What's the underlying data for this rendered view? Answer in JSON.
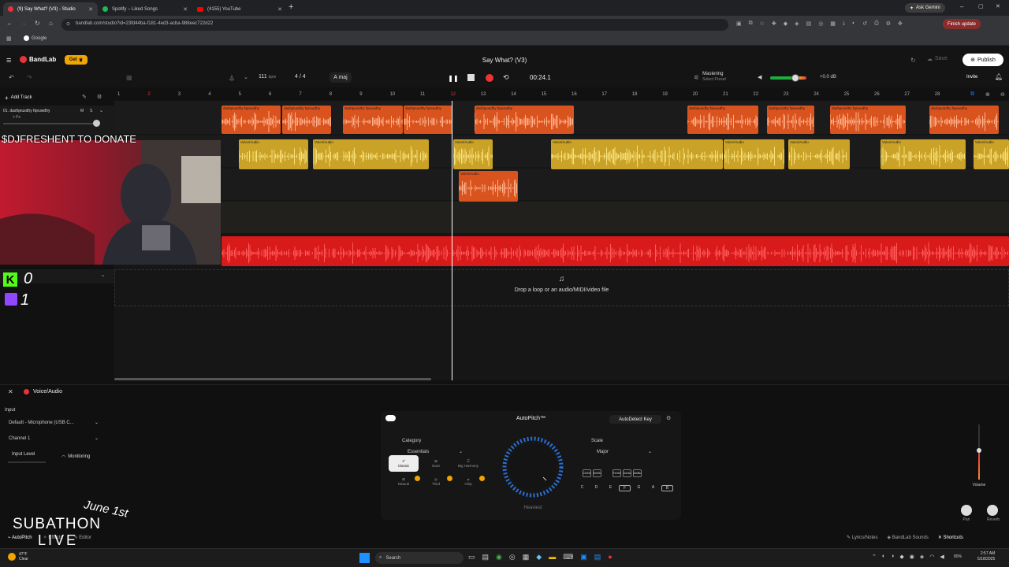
{
  "browser": {
    "tabs": [
      {
        "label": "(9) Say What? (V3) - Studio",
        "active": true
      },
      {
        "label": "Spotify – Liked Songs",
        "active": false
      },
      {
        "label": "(4155) YouTube",
        "active": false
      }
    ],
    "url": "bandlab.com/studio?id=23fd44ba-f181-4ed3-acba-988eec722d22",
    "bookmark": "Google",
    "ask_gemini": "Ask Gemini",
    "finish_update": "Finish update"
  },
  "header": {
    "brand": "BandLab",
    "get_label": "Get",
    "project_title": "Say What? (V3)",
    "save_label": "Save",
    "publish_label": "Publish",
    "invite_label": "Invite",
    "bpm": "111",
    "bpm_unit": "bpm",
    "time_sig": "4 / 4",
    "key": "A maj",
    "time": "00:24.1",
    "mastering_title": "Mastering",
    "mastering_sub": "Select Preset",
    "master_db": "+0.0 dB",
    "master_volume": 0.7
  },
  "sidebar": {
    "add_track": "Add Track",
    "track1_name": "01. dasfqeusdhy fqeuwdhy",
    "track1_fx": "+ Fx",
    "m": "M",
    "s": "S"
  },
  "ruler": [
    "1",
    "2",
    "3",
    "4",
    "5",
    "6",
    "7",
    "8",
    "9",
    "10",
    "11",
    "12",
    "13",
    "14",
    "15",
    "16",
    "17",
    "18",
    "19",
    "20",
    "21",
    "22",
    "23",
    "24",
    "25",
    "26",
    "27",
    "28"
  ],
  "clips": {
    "orange_label": "dasfqeusdhy fqeuwdhy",
    "voice_label": "Voice/Audio"
  },
  "drop_hint": "Drop a loop or an audio/MIDI/video file",
  "overlay": {
    "donate": "$DJFRESHENT TO DONATE",
    "kick_count": "0",
    "twitch_count": "1",
    "subathon": "SUBATHON",
    "live": "LIVE",
    "date": "June 1st"
  },
  "panel": {
    "track_name": "Voice/Audio",
    "input_label": "Input",
    "input_device": "Default - Microphone (USB C...",
    "channel": "Channel 1",
    "input_level": "Input Level",
    "monitoring": "Monitoring",
    "effect_title": "AutoPitch™",
    "autodetect": "AutoDetect Key",
    "category_label": "Category",
    "category_value": "Essentials",
    "scale_label": "Scale",
    "scale_value": "Major",
    "effects": [
      "Classic",
      "Duet",
      "Big Harmony",
      "Natural",
      "Third",
      "Chip"
    ],
    "knob_label": "Heaviest",
    "sharp_keys": [
      "C#/Db",
      "D#/Eb",
      "F#/Gb",
      "G#/Ab",
      "A#/Bb"
    ],
    "keys": [
      "C",
      "D",
      "E",
      "F",
      "G",
      "A",
      "B"
    ],
    "volume_label": "Volume",
    "pan_label": "Pan",
    "reverb_label": "Reverb",
    "bottom_tabs": [
      "AutoPitch",
      "Effects",
      "Editor"
    ],
    "lyrics": "Lyrics/Notes",
    "sounds": "BandLab Sounds",
    "shortcuts": "Shortcuts"
  },
  "taskbar": {
    "search": "Search",
    "weather_temp": "47°F",
    "weather_desc": "Clear",
    "time": "2:57 AM",
    "date": "5/18/2025",
    "battery": "80%"
  },
  "colors": {
    "orange_clip": "#d9531e",
    "yellow_clip": "#c9a227",
    "red_track": "#d81a1a",
    "brand_red": "#e8333a",
    "record": "#e33"
  }
}
